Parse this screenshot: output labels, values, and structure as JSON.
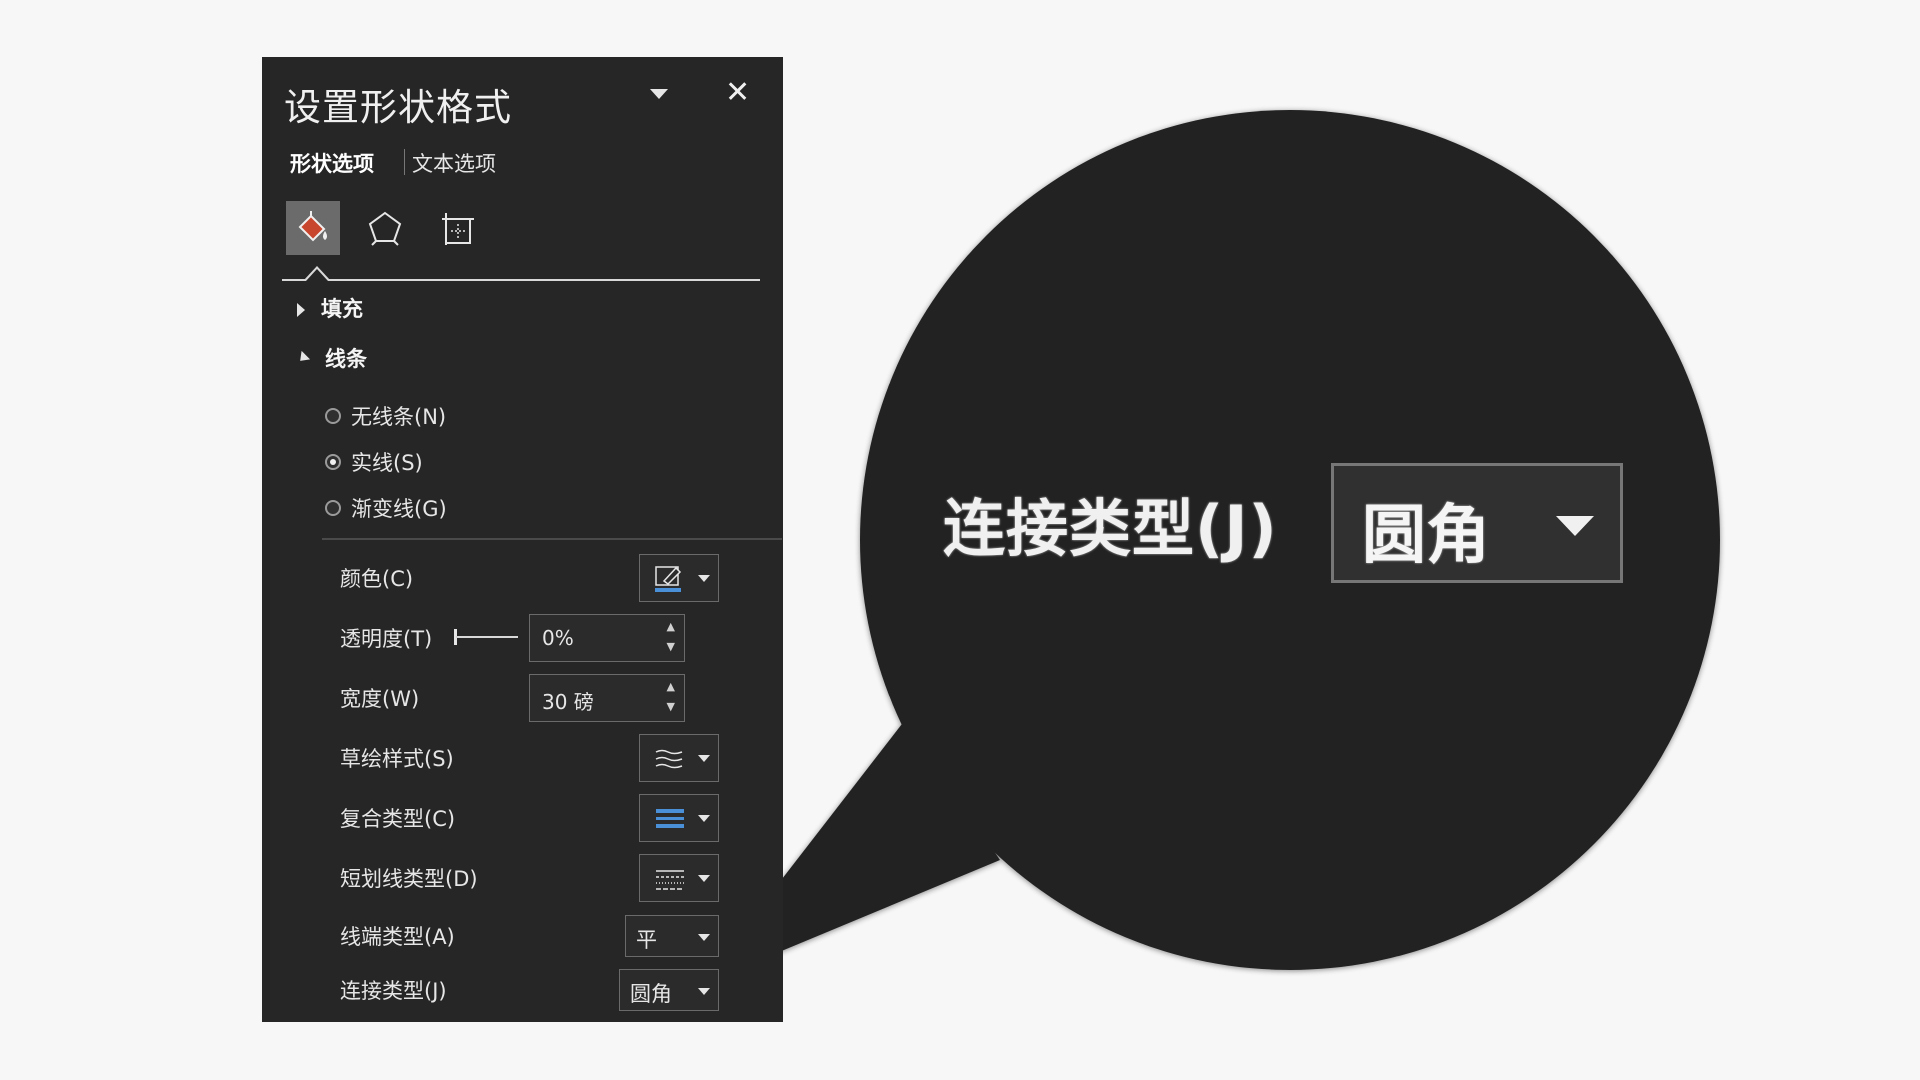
{
  "pane": {
    "title": "设置形状格式",
    "close": "✕",
    "tabs": [
      "形状选项",
      "文本选项"
    ],
    "icons": [
      "fill-line-icon",
      "shape-effects-icon",
      "size-properties-icon"
    ]
  },
  "sections": {
    "fill": "填充",
    "line": "线条"
  },
  "line_options": {
    "none": "无线条(N)",
    "solid": "实线(S)",
    "gradient": "渐变线(G)",
    "selected": "solid"
  },
  "properties": {
    "color_label": "颜色(C)",
    "transparency_label": "透明度(T)",
    "transparency_value": "0%",
    "width_label": "宽度(W)",
    "width_value": "30 磅",
    "sketch_label": "草绘样式(S)",
    "compound_label": "复合类型(C)",
    "dash_label": "短划线类型(D)",
    "cap_label": "线端类型(A)",
    "cap_value": "平",
    "join_label": "连接类型(J)",
    "join_value": "圆角"
  },
  "colors": {
    "panel": "#262626",
    "accent_fill": "#c8462e",
    "compound_blue": "#4a90d9"
  }
}
